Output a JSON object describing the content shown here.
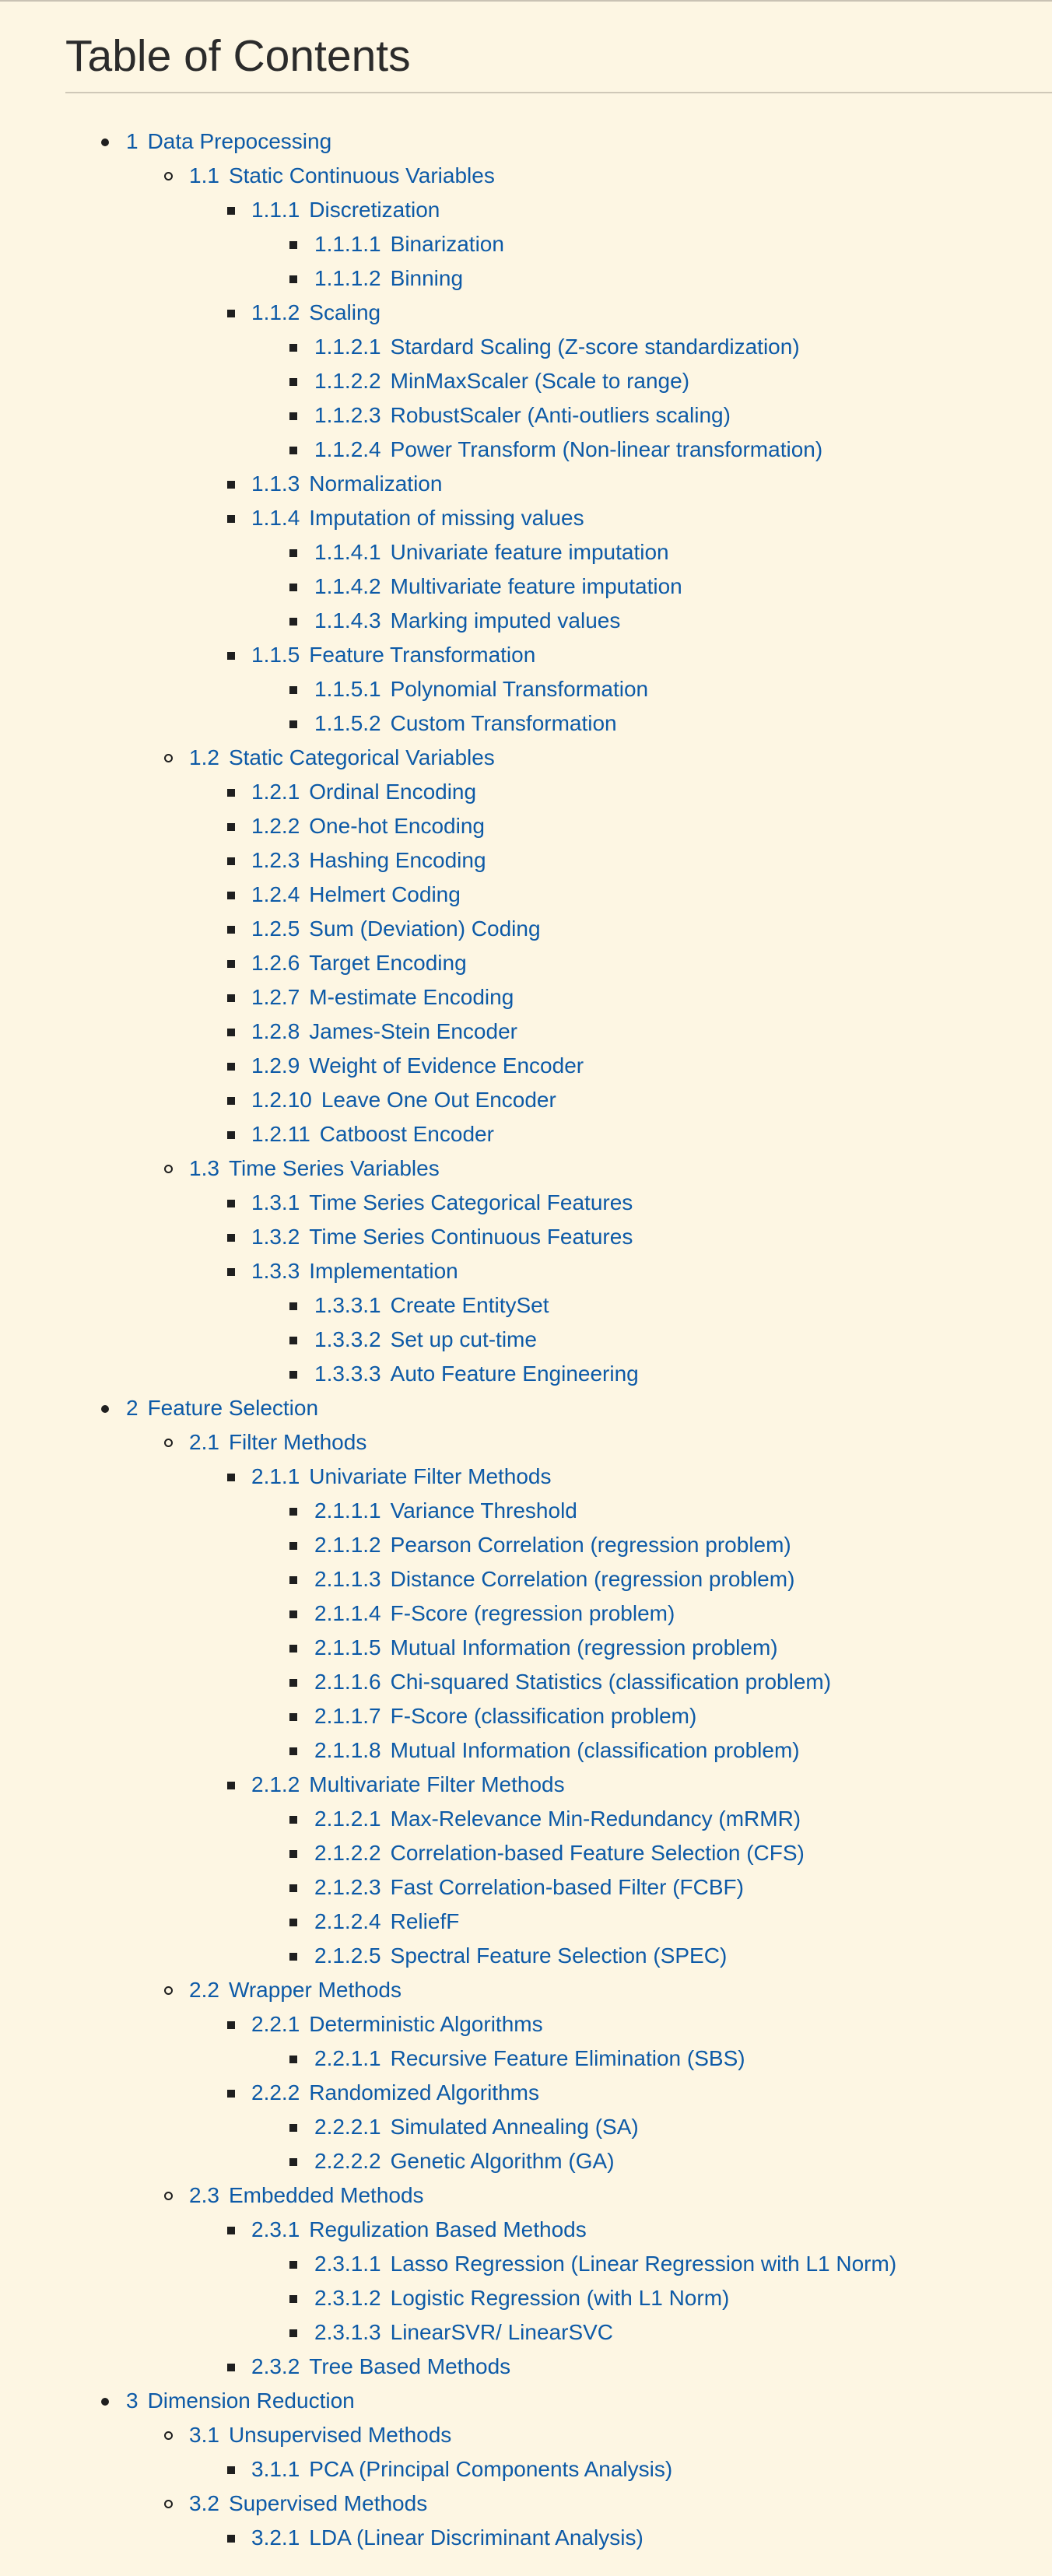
{
  "toc": {
    "title": "Table of Contents",
    "items": [
      {
        "level": 0,
        "number": "1",
        "text": "Data Prepocessing"
      },
      {
        "level": 1,
        "number": "1.1",
        "text": "Static Continuous Variables"
      },
      {
        "level": 2,
        "number": "1.1.1",
        "text": "Discretization"
      },
      {
        "level": 3,
        "number": "1.1.1.1",
        "text": "Binarization"
      },
      {
        "level": 3,
        "number": "1.1.1.2",
        "text": "Binning"
      },
      {
        "level": 2,
        "number": "1.1.2",
        "text": "Scaling"
      },
      {
        "level": 3,
        "number": "1.1.2.1",
        "text": "Stardard Scaling (Z-score standardization)"
      },
      {
        "level": 3,
        "number": "1.1.2.2",
        "text": "MinMaxScaler (Scale to range)"
      },
      {
        "level": 3,
        "number": "1.1.2.3",
        "text": "RobustScaler (Anti-outliers scaling)"
      },
      {
        "level": 3,
        "number": "1.1.2.4",
        "text": "Power Transform (Non-linear transformation)"
      },
      {
        "level": 2,
        "number": "1.1.3",
        "text": "Normalization"
      },
      {
        "level": 2,
        "number": "1.1.4",
        "text": "Imputation of missing values"
      },
      {
        "level": 3,
        "number": "1.1.4.1",
        "text": "Univariate feature imputation"
      },
      {
        "level": 3,
        "number": "1.1.4.2",
        "text": "Multivariate feature imputation"
      },
      {
        "level": 3,
        "number": "1.1.4.3",
        "text": "Marking imputed values"
      },
      {
        "level": 2,
        "number": "1.1.5",
        "text": "Feature Transformation"
      },
      {
        "level": 3,
        "number": "1.1.5.1",
        "text": "Polynomial Transformation"
      },
      {
        "level": 3,
        "number": "1.1.5.2",
        "text": "Custom Transformation"
      },
      {
        "level": 1,
        "number": "1.2",
        "text": "Static Categorical Variables"
      },
      {
        "level": 2,
        "number": "1.2.1",
        "text": "Ordinal Encoding"
      },
      {
        "level": 2,
        "number": "1.2.2",
        "text": "One-hot Encoding"
      },
      {
        "level": 2,
        "number": "1.2.3",
        "text": "Hashing Encoding"
      },
      {
        "level": 2,
        "number": "1.2.4",
        "text": "Helmert Coding"
      },
      {
        "level": 2,
        "number": "1.2.5",
        "text": "Sum (Deviation) Coding"
      },
      {
        "level": 2,
        "number": "1.2.6",
        "text": "Target Encoding"
      },
      {
        "level": 2,
        "number": "1.2.7",
        "text": "M-estimate Encoding"
      },
      {
        "level": 2,
        "number": "1.2.8",
        "text": "James-Stein Encoder"
      },
      {
        "level": 2,
        "number": "1.2.9",
        "text": "Weight of Evidence Encoder"
      },
      {
        "level": 2,
        "number": "1.2.10",
        "text": "Leave One Out Encoder"
      },
      {
        "level": 2,
        "number": "1.2.11",
        "text": "Catboost Encoder"
      },
      {
        "level": 1,
        "number": "1.3",
        "text": "Time Series Variables"
      },
      {
        "level": 2,
        "number": "1.3.1",
        "text": "Time Series Categorical Features"
      },
      {
        "level": 2,
        "number": "1.3.2",
        "text": "Time Series Continuous Features"
      },
      {
        "level": 2,
        "number": "1.3.3",
        "text": "Implementation"
      },
      {
        "level": 3,
        "number": "1.3.3.1",
        "text": "Create EntitySet"
      },
      {
        "level": 3,
        "number": "1.3.3.2",
        "text": "Set up cut-time"
      },
      {
        "level": 3,
        "number": "1.3.3.3",
        "text": "Auto Feature Engineering"
      },
      {
        "level": 0,
        "number": "2",
        "text": "Feature Selection"
      },
      {
        "level": 1,
        "number": "2.1",
        "text": "Filter Methods"
      },
      {
        "level": 2,
        "number": "2.1.1",
        "text": "Univariate Filter Methods"
      },
      {
        "level": 3,
        "number": "2.1.1.1",
        "text": "Variance Threshold"
      },
      {
        "level": 3,
        "number": "2.1.1.2",
        "text": "Pearson Correlation (regression problem)"
      },
      {
        "level": 3,
        "number": "2.1.1.3",
        "text": "Distance Correlation (regression problem)"
      },
      {
        "level": 3,
        "number": "2.1.1.4",
        "text": "F-Score (regression problem)"
      },
      {
        "level": 3,
        "number": "2.1.1.5",
        "text": "Mutual Information (regression problem)"
      },
      {
        "level": 3,
        "number": "2.1.1.6",
        "text": "Chi-squared Statistics (classification problem)"
      },
      {
        "level": 3,
        "number": "2.1.1.7",
        "text": "F-Score (classification problem)"
      },
      {
        "level": 3,
        "number": "2.1.1.8",
        "text": "Mutual Information (classification problem)"
      },
      {
        "level": 2,
        "number": "2.1.2",
        "text": "Multivariate Filter Methods"
      },
      {
        "level": 3,
        "number": "2.1.2.1",
        "text": "Max-Relevance Min-Redundancy (mRMR)"
      },
      {
        "level": 3,
        "number": "2.1.2.2",
        "text": "Correlation-based Feature Selection (CFS)"
      },
      {
        "level": 3,
        "number": "2.1.2.3",
        "text": "Fast Correlation-based Filter (FCBF)"
      },
      {
        "level": 3,
        "number": "2.1.2.4",
        "text": "ReliefF"
      },
      {
        "level": 3,
        "number": "2.1.2.5",
        "text": "Spectral Feature Selection (SPEC)"
      },
      {
        "level": 1,
        "number": "2.2",
        "text": "Wrapper Methods"
      },
      {
        "level": 2,
        "number": "2.2.1",
        "text": "Deterministic Algorithms"
      },
      {
        "level": 3,
        "number": "2.2.1.1",
        "text": "Recursive Feature Elimination (SBS)"
      },
      {
        "level": 2,
        "number": "2.2.2",
        "text": "Randomized Algorithms"
      },
      {
        "level": 3,
        "number": "2.2.2.1",
        "text": "Simulated Annealing (SA)"
      },
      {
        "level": 3,
        "number": "2.2.2.2",
        "text": "Genetic Algorithm (GA)"
      },
      {
        "level": 1,
        "number": "2.3",
        "text": "Embedded Methods"
      },
      {
        "level": 2,
        "number": "2.3.1",
        "text": "Regulization Based Methods"
      },
      {
        "level": 3,
        "number": "2.3.1.1",
        "text": "Lasso Regression (Linear Regression with L1 Norm)"
      },
      {
        "level": 3,
        "number": "2.3.1.2",
        "text": "Logistic Regression (with L1 Norm)"
      },
      {
        "level": 3,
        "number": "2.3.1.3",
        "text": "LinearSVR/ LinearSVC"
      },
      {
        "level": 2,
        "number": "2.3.2",
        "text": "Tree Based Methods"
      },
      {
        "level": 0,
        "number": "3",
        "text": "Dimension Reduction"
      },
      {
        "level": 1,
        "number": "3.1",
        "text": "Unsupervised Methods"
      },
      {
        "level": 2,
        "number": "3.1.1",
        "text": "PCA (Principal Components Analysis)"
      },
      {
        "level": 1,
        "number": "3.2",
        "text": "Supervised Methods"
      },
      {
        "level": 2,
        "number": "3.2.1",
        "text": "LDA (Linear Discriminant Analysis)"
      }
    ]
  },
  "colors": {
    "background": "#fdf6e3",
    "link": "#0d5aa7",
    "title": "#2b2b2b"
  }
}
